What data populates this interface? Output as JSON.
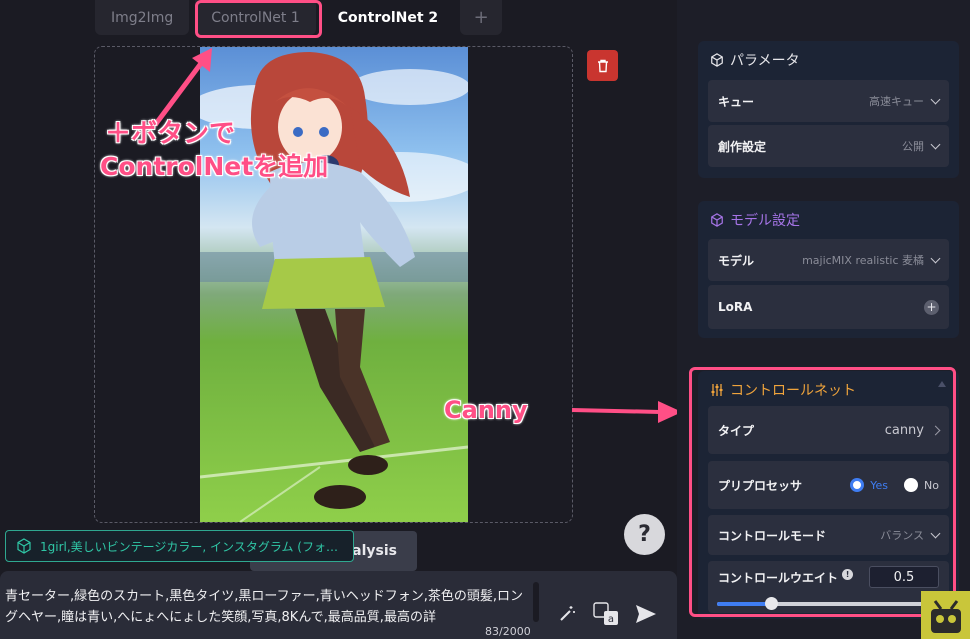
{
  "tabs": [
    {
      "label": "Img2Img"
    },
    {
      "label": "ControlNet 1"
    },
    {
      "label": "ControlNet 2"
    },
    {
      "label": "+"
    }
  ],
  "annotations": {
    "add_text_line1": "＋ボタンで",
    "add_text_line2": "ControlNetを追加",
    "canny_text": "Canny"
  },
  "help_label": "?",
  "tag_chip": "1girl,美しいビンテージカラー, インスタグラム (フォ…",
  "analysis_label": "nalysis",
  "prompt": {
    "text": "青セーター,緑色のスカート,黒色タイツ,黒ローファー,青いヘッドフォン,茶色の頭髪,ロングヘヤー,瞳は青い,へにょへにょした笑顔,写真,8Kんで,最高品質,最高の詳",
    "counter": "83/2000"
  },
  "params": {
    "title": "パラメータ",
    "queue_label": "キュー",
    "queue_value": "高速キュー",
    "creation_label": "創作設定",
    "creation_value": "公開"
  },
  "model": {
    "title": "モデル設定",
    "model_label": "モデル",
    "model_value": "majicMIX realistic 麦橘",
    "lora_label": "LoRA"
  },
  "controlnet": {
    "title": "コントロールネット",
    "type_label": "タイプ",
    "type_value": "canny",
    "preproc_label": "プリプロセッサ",
    "preproc_yes": "Yes",
    "preproc_no": "No",
    "preproc_selected": "Yes",
    "mode_label": "コントロールモード",
    "mode_value": "バランス",
    "weight_label": "コントロールウエイト",
    "weight_value": "0.5",
    "weight_fraction": 0.25
  },
  "colors": {
    "accent": "#3f7df2",
    "annotation": "#ff4f86",
    "delete": "#c9352f",
    "params_title": "#e6e6ea",
    "model_title": "#a574e6",
    "controlnet_title": "#f0a43c"
  }
}
